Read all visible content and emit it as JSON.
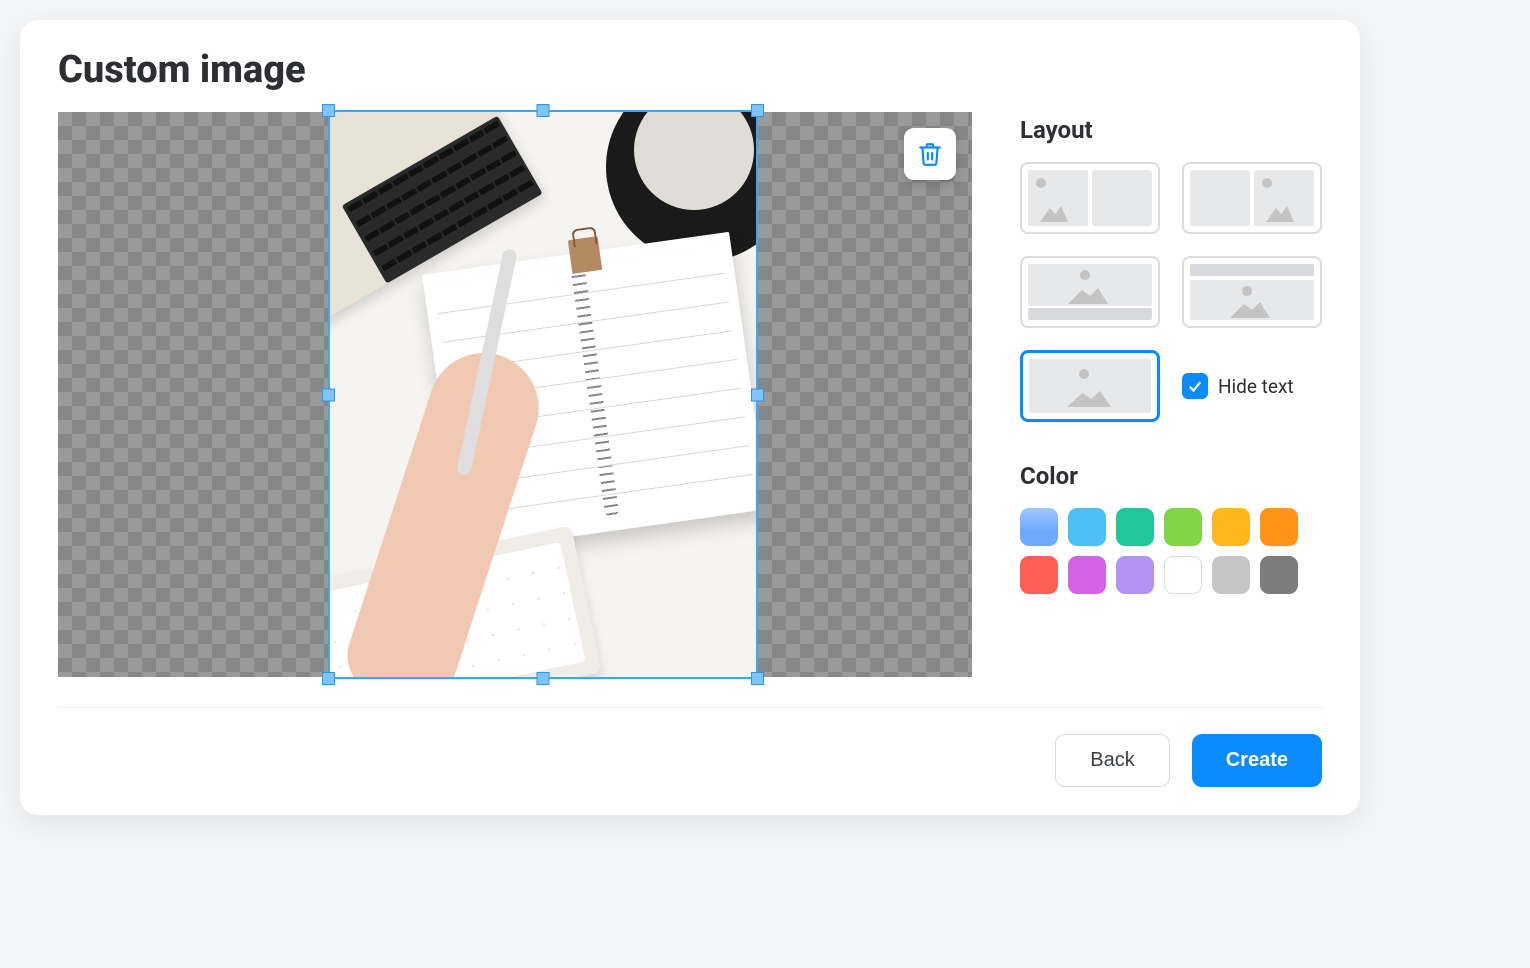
{
  "title": "Custom image",
  "icons": {
    "trash": "trash-icon"
  },
  "layout": {
    "section_title": "Layout",
    "options": [
      {
        "id": "image-left",
        "selected": false
      },
      {
        "id": "image-right",
        "selected": false
      },
      {
        "id": "image-banner-bottom",
        "selected": false
      },
      {
        "id": "image-banner-top",
        "selected": false
      },
      {
        "id": "image-full",
        "selected": true
      }
    ],
    "hide_text": {
      "label": "Hide text",
      "checked": true
    }
  },
  "color": {
    "section_title": "Color",
    "swatches": [
      {
        "hex": "#6fa9ff",
        "selected": true
      },
      {
        "hex": "#4fc0f4",
        "selected": false
      },
      {
        "hex": "#23c59a",
        "selected": false
      },
      {
        "hex": "#82d545",
        "selected": false
      },
      {
        "hex": "#ffb81c",
        "selected": false
      },
      {
        "hex": "#ff9518",
        "selected": false
      },
      {
        "hex": "#ff5e57",
        "selected": false
      },
      {
        "hex": "#d264e3",
        "selected": false
      },
      {
        "hex": "#b393f2",
        "selected": false
      },
      {
        "hex": "#ffffff",
        "selected": false
      },
      {
        "hex": "#c5c5c5",
        "selected": false
      },
      {
        "hex": "#7d7d7d",
        "selected": false
      }
    ]
  },
  "footer": {
    "back_label": "Back",
    "create_label": "Create"
  }
}
